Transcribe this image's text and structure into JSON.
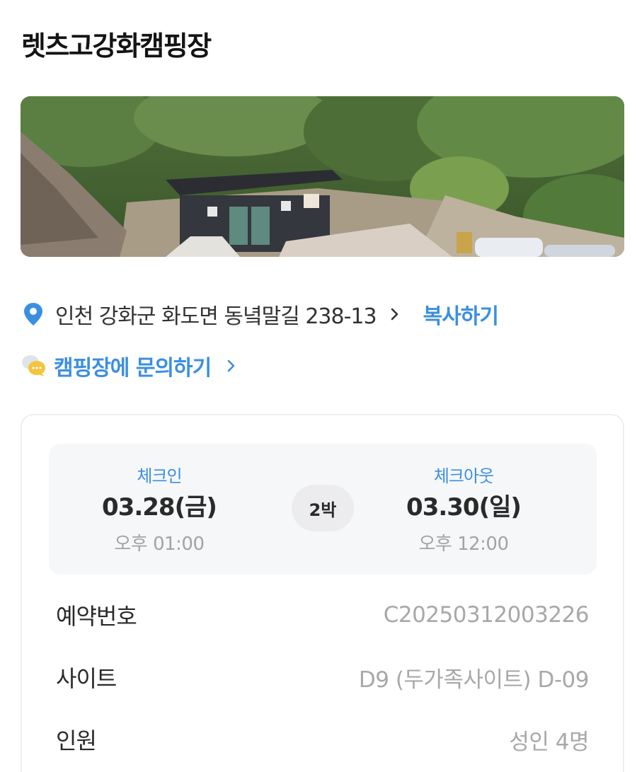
{
  "camp": {
    "name": "렛츠고강화캠핑장"
  },
  "location": {
    "address": "인천 강화군 화도면 동녘말길 238-13",
    "copy_label": "복사하기",
    "pin_icon": "location-pin-icon",
    "accent": "#3b8fe0"
  },
  "inquiry": {
    "label": "캠핑장에 문의하기",
    "icon": "chat-bubble-icon"
  },
  "stay": {
    "checkin_label": "체크인",
    "checkin_date": "03.28(금)",
    "checkin_time": "오후 01:00",
    "nights": "2박",
    "checkout_label": "체크아웃",
    "checkout_date": "03.30(일)",
    "checkout_time": "오후 12:00"
  },
  "details": [
    {
      "label": "예약번호",
      "value": "C20250312003226"
    },
    {
      "label": "사이트",
      "value": "D9 (두가족사이트) D-09"
    },
    {
      "label": "인원",
      "value": "성인 4명"
    }
  ]
}
